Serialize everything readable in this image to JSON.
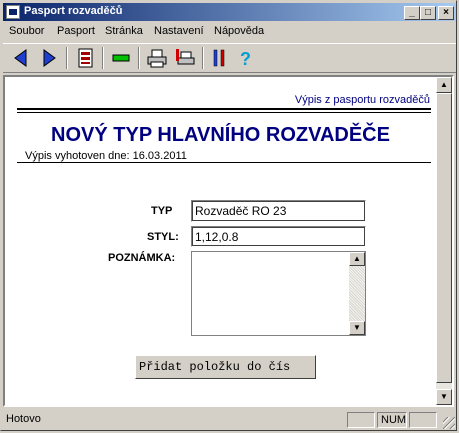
{
  "window": {
    "title": "Pasport rozvaděčů"
  },
  "menu": [
    "Soubor",
    "Pasport",
    "Stránka",
    "Nastavení",
    "Nápověda"
  ],
  "toolbar": {
    "icons": [
      "back-arrow-icon",
      "forward-arrow-icon",
      "document-icon",
      "insert-row-icon",
      "print-icon",
      "print-setup-icon",
      "tools-icon",
      "help-icon"
    ]
  },
  "page": {
    "header_right": "Výpis z pasportu rozvaděčů",
    "title": "NOVÝ TYP HLAVNÍHO ROZVADĚČE",
    "date_line": "Výpis vyhotoven dne: 16.03.2011"
  },
  "form": {
    "typ_label": "TYP",
    "typ_value": "Rozvaděč RO 23",
    "styl_label": "STYL:",
    "styl_value": "1,12,0.8",
    "poznamka_label": "POZNÁMKA:",
    "poznamka_value": "",
    "add_button": "Přidat položku do čís"
  },
  "status": {
    "text": "Hotovo",
    "num": "NUM"
  },
  "colors": {
    "title_blue": "#000080",
    "titlebar_start": "#0a246a",
    "titlebar_end": "#a6caf0"
  }
}
